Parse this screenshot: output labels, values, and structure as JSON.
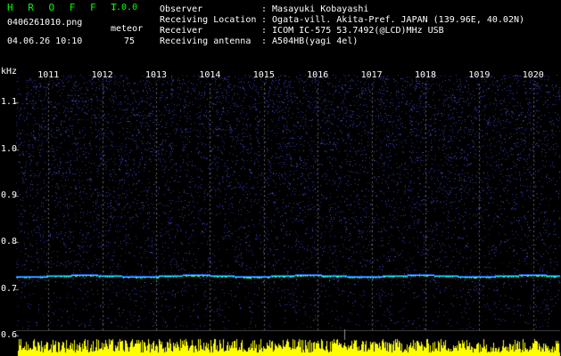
{
  "header": {
    "app_name": "H R O F F T",
    "app_version": "1.0.0",
    "file_name": "0406261010.png",
    "meteor_label": "meteor",
    "datetime": "04.06.26 10:10",
    "meteor_count": "75",
    "info": [
      {
        "key": "Observer",
        "value": ": Masayuki Kobayashi"
      },
      {
        "key": "Receiving Location",
        "value": ": Ogata-vill. Akita-Pref. JAPAN (139.96E, 40.02N)"
      },
      {
        "key": "Receiver",
        "value": ": ICOM IC-575 53.7492(@LCD)MHz USB"
      },
      {
        "key": "Receiving antenna",
        "value": ": A504HB(yagi 4el)"
      }
    ]
  },
  "chart_data": {
    "type": "heatmap",
    "ylabel": "kHz",
    "x_ticks": [
      "1011",
      "1012",
      "1013",
      "1014",
      "1015",
      "1016",
      "1017",
      "1018",
      "1019",
      "1020"
    ],
    "y_ticks": [
      "1.1",
      "1.0",
      "0.9",
      "0.8",
      "0.7",
      "0.6"
    ],
    "x_range": [
      1010.4,
      1020.5
    ],
    "y_range": [
      0.56,
      1.16
    ],
    "carrier_khz": 0.728,
    "colors": {
      "noise": "#3030c8",
      "trace": "#00ffff",
      "amplitude": "#ffff00",
      "grid": "#606060"
    }
  }
}
